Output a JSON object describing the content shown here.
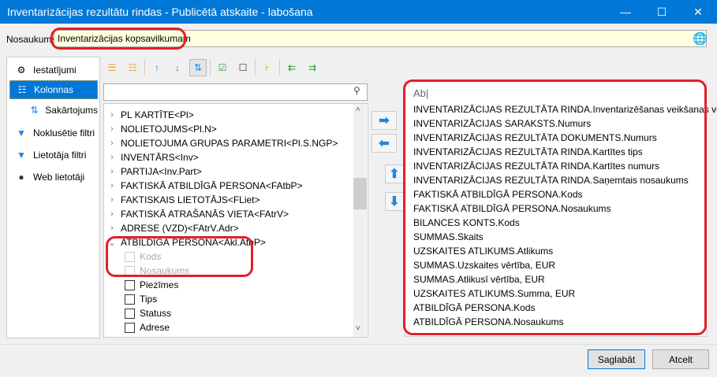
{
  "window": {
    "title": "Inventarizācijas rezultātu rindas - Publicētā atskaite - labošana",
    "minimize": "—",
    "maximize": "☐",
    "close": "✕"
  },
  "name": {
    "label": "Nosaukums:",
    "value": "Inventarizācijas kopsavilkumam",
    "globe_icon": "globe-icon"
  },
  "nav": [
    {
      "label": "Iestatījumi",
      "icon": "gear-icon"
    },
    {
      "label": "Kolonnas",
      "icon": "columns-icon",
      "selected": true
    },
    {
      "label": "Sakārtojums",
      "icon": "sort-icon"
    },
    {
      "label": "Noklusētie filtri",
      "icon": "filter-icon"
    },
    {
      "label": "Lietotāja filtri",
      "icon": "user-filter-icon"
    },
    {
      "label": "Web lietotāji",
      "icon": "user-icon"
    }
  ],
  "toolbar": [
    "expand-all",
    "collapse-all",
    "sort-asc",
    "sort-desc",
    "sort-toggle",
    "check-all",
    "uncheck-all",
    "tree-select",
    "move-left",
    "move-right"
  ],
  "search": {
    "placeholder": ""
  },
  "tree": [
    {
      "label": "PL KARTĪTE<Pl>",
      "type": "collapsed"
    },
    {
      "label": "NOLIETOJUMS<Pl.N>",
      "type": "collapsed"
    },
    {
      "label": "NOLIETOJUMA GRUPAS PARAMETRI<Pl.S.NGP>",
      "type": "collapsed"
    },
    {
      "label": "INVENTĀRS<Inv>",
      "type": "collapsed"
    },
    {
      "label": "PARTIJA<Inv.Part>",
      "type": "collapsed"
    },
    {
      "label": "FAKTISKĀ ATBILDĪGĀ PERSONA<FAtbP>",
      "type": "collapsed"
    },
    {
      "label": "FAKTISKAIS LIETOTĀJS<FLiet>",
      "type": "collapsed"
    },
    {
      "label": "FAKTISKĀ ATRAŠANĀS VIETA<FAtrV>",
      "type": "collapsed"
    },
    {
      "label": "ADRESE (VZD)<FAtrV.Adr>",
      "type": "collapsed"
    },
    {
      "label": "ATBILDĪGĀ PERSONA<Akl.AtbP>",
      "type": "expanded"
    },
    {
      "label": "Kods",
      "type": "child",
      "disabled": true
    },
    {
      "label": "Nosaukums",
      "type": "child",
      "disabled": true
    },
    {
      "label": "Piezīmes",
      "type": "child"
    },
    {
      "label": "Tips",
      "type": "child"
    },
    {
      "label": "Statuss",
      "type": "child"
    },
    {
      "label": "Adrese",
      "type": "child"
    }
  ],
  "columns": {
    "input": "Ab|",
    "items": [
      "INVENTARIZĀCIJAS REZULTĀTA RINDA.Inventarizēšanas veikšanas veids",
      "INVENTARIZĀCIJAS SARAKSTS.Numurs",
      "INVENTARIZĀCIJAS REZULTĀTA DOKUMENTS.Numurs",
      "INVENTARIZĀCIJAS REZULTĀTA RINDA.Kartītes tips",
      "INVENTARIZĀCIJAS REZULTĀTA RINDA.Kartītes numurs",
      "INVENTARIZĀCIJAS REZULTĀTA RINDA.Saņemtais nosaukums",
      "FAKTISKĀ ATBILDĪGĀ PERSONA.Kods",
      "FAKTISKĀ ATBILDĪGĀ PERSONA.Nosaukums",
      "BILANCES KONTS.Kods",
      "SUMMAS.Skaits",
      "UZSKAITES ATLIKUMS.Atlikums",
      "SUMMAS.Uzskaites vērtība, EUR",
      "SUMMAS.Atlikusī vērtība, EUR",
      "UZSKAITES ATLIKUMS.Summa, EUR",
      "ATBILDĪGĀ PERSONA.Kods",
      "ATBILDĪGĀ PERSONA.Nosaukums"
    ]
  },
  "buttons": {
    "save": "Saglabāt",
    "cancel": "Atcelt"
  },
  "colors": {
    "accent": "#0078d7",
    "highlight": "#e0202a",
    "name_bg": "#ffffe1"
  }
}
